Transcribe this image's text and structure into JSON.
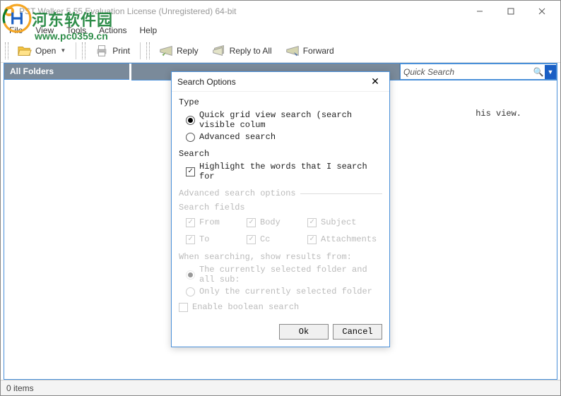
{
  "window": {
    "title": "PST Walker 5.55 Evaluation License (Unregistered) 64-bit"
  },
  "menu": {
    "file": "File",
    "view": "View",
    "tools": "Tools",
    "actions": "Actions",
    "help": "Help"
  },
  "toolbar": {
    "open": "Open",
    "print": "Print",
    "reply": "Reply",
    "reply_all": "Reply to All",
    "forward": "Forward"
  },
  "sidebar": {
    "header": "All Folders"
  },
  "search": {
    "placeholder": "Quick Search"
  },
  "main": {
    "message_fragment": "his view."
  },
  "dialog": {
    "title": "Search Options",
    "type_label": "Type",
    "quick_radio": "Quick grid view search (search visible colum",
    "advanced_radio": "Advanced search",
    "search_label": "Search",
    "highlight_check": "Highlight the words that I search for",
    "adv_header": "Advanced search options",
    "fields_label": "Search fields",
    "from": "From",
    "body": "Body",
    "subject": "Subject",
    "to": "To",
    "cc": "Cc",
    "attachments": "Attachments",
    "results_label": "When searching, show results from:",
    "results_all": "The currently selected folder and all sub:",
    "results_only": "Only the currently selected folder",
    "boolean": "Enable boolean search",
    "ok": "Ok",
    "cancel": "Cancel"
  },
  "status": {
    "items": "0 items"
  },
  "watermark": {
    "text": "河东软件园",
    "url": "www.pc0359.cn"
  }
}
